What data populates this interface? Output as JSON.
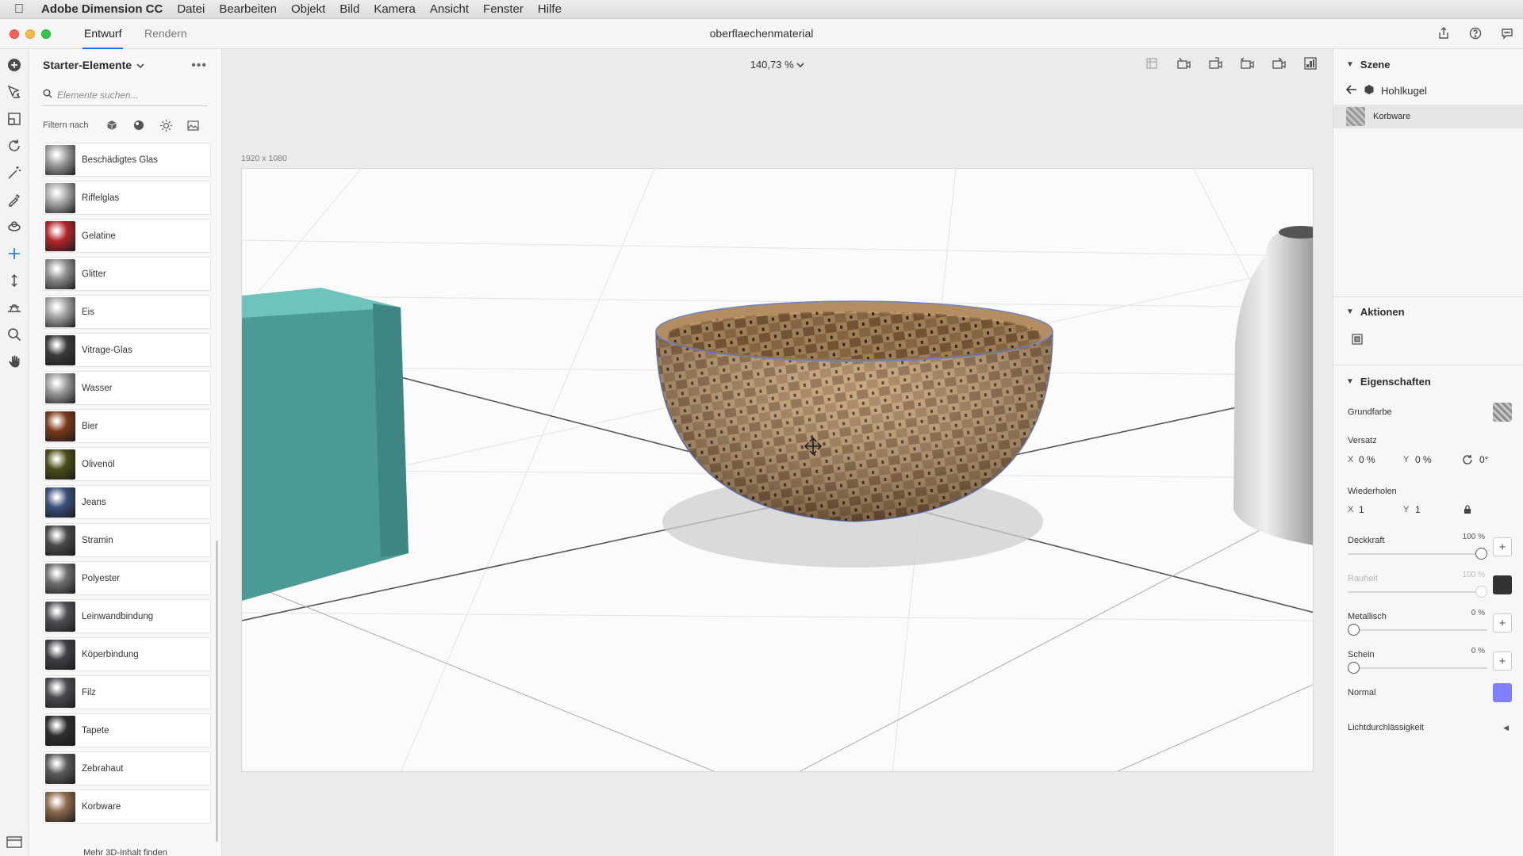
{
  "menubar": {
    "app_name": "Adobe Dimension CC",
    "items": [
      "Datei",
      "Bearbeiten",
      "Objekt",
      "Bild",
      "Kamera",
      "Ansicht",
      "Fenster",
      "Hilfe"
    ]
  },
  "titlebar": {
    "tabs": [
      {
        "label": "Entwurf",
        "active": true
      },
      {
        "label": "Rendern",
        "active": false
      }
    ],
    "document_title": "oberflaechenmaterial"
  },
  "assets": {
    "header": "Starter-Elemente",
    "search_placeholder": "Elemente suchen...",
    "filter_label": "Filtern nach",
    "items": [
      {
        "label": "Beschädigtes Glas",
        "color": "#9c9c9c"
      },
      {
        "label": "Riffelglas",
        "color": "#a8a8a8"
      },
      {
        "label": "Gelatine",
        "color": "#b3262a"
      },
      {
        "label": "Glitter",
        "color": "#8e8e8e"
      },
      {
        "label": "Eis",
        "color": "#a3a3a3"
      },
      {
        "label": "Vitrage-Glas",
        "color": "#3a3a3a"
      },
      {
        "label": "Wasser",
        "color": "#9a9a9a"
      },
      {
        "label": "Bier",
        "color": "#7a3a1a"
      },
      {
        "label": "Olivenöl",
        "color": "#4b4d17"
      },
      {
        "label": "Jeans",
        "color": "#3a4f7a"
      },
      {
        "label": "Stramin",
        "color": "#4a4a4a"
      },
      {
        "label": "Polyester",
        "color": "#6e6e6e"
      },
      {
        "label": "Leinwandbindung",
        "color": "#505055"
      },
      {
        "label": "Köperbindung",
        "color": "#3f4045"
      },
      {
        "label": "Filz",
        "color": "#4a4b50"
      },
      {
        "label": "Tapete",
        "color": "#2e2e2e"
      },
      {
        "label": "Zebrahaut",
        "color": "#5a5a5a"
      },
      {
        "label": "Korbware",
        "color": "#8d6a4b"
      }
    ],
    "footer": "Mehr 3D-Inhalt finden"
  },
  "viewport": {
    "zoom": "140,73 %",
    "canvas_size": "1920 x 1080"
  },
  "props": {
    "scene": {
      "title": "Szene",
      "parent": "Hohlkugel",
      "child": "Korbware"
    },
    "actions": {
      "title": "Aktionen"
    },
    "properties": {
      "title": "Eigenschaften",
      "base_color": "Grundfarbe",
      "offset": {
        "label": "Versatz",
        "x_axis": "X",
        "x": "0 %",
        "y_axis": "Y",
        "y": "0 %",
        "rot": "0°"
      },
      "repeat": {
        "label": "Wiederholen",
        "x_axis": "X",
        "x": "1",
        "y_axis": "Y",
        "y": "1"
      },
      "opacity": {
        "label": "Deckkraft",
        "value": "100 %",
        "level": 1.0
      },
      "roughness": {
        "label": "Rauheit",
        "value": "100 %",
        "level": 1.0
      },
      "metallic": {
        "label": "Metallisch",
        "value": "0 %",
        "level": 0.0
      },
      "glow": {
        "label": "Schein",
        "value": "0 %",
        "level": 0.0
      },
      "normal": {
        "label": "Normal"
      },
      "translucency": {
        "label": "Lichtdurchlässigkeit"
      }
    },
    "colors": {
      "roughness_swatch": "#333333",
      "normal_swatch": "#8080ff"
    }
  }
}
